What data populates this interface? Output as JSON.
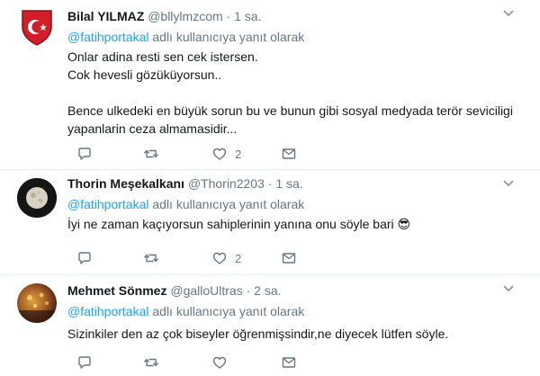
{
  "tweets": [
    {
      "name": "Bilal YILMAZ",
      "handle": "@bllylmzcom",
      "time": "1 sa.",
      "reply_mention": "@fatihportakal",
      "reply_suffix": " adlı kullanıcıya yanıt olarak",
      "lines": [
        "Onlar adina resti sen cek istersen.",
        "Cok hevesli gözüküyorsun..",
        "",
        "Bence ulkedeki en büyük sorun bu ve bunun gibi sosyal medyada terör seviciligi yapanlarin ceza almamasidir..."
      ],
      "likes": "2"
    },
    {
      "name": "Thorin Meşekalkanı",
      "handle": "@Thorin2203",
      "time": "1 sa.",
      "reply_mention": "@fatihportakal",
      "reply_suffix": " adlı kullanıcıya yanıt olarak",
      "lines": [
        "İyi ne zaman kaçıyorsun sahiplerinin yanına onu söyle bari"
      ],
      "emoji": "😎",
      "likes": "2"
    },
    {
      "name": "Mehmet Sönmez",
      "handle": "@galloUltras",
      "time": "2 sa.",
      "reply_mention": "@fatihportakal",
      "reply_suffix": " adlı kullanıcıya yanıt olarak",
      "lines": [
        "Sizinkiler den az çok biseyler öğrenmişsindir,ne diyecek lütfen söyle."
      ]
    }
  ],
  "separator": "·",
  "icons": {
    "reply": "reply-icon",
    "retweet": "retweet-icon",
    "like": "heart-icon",
    "message": "direct-message-icon",
    "more": "chevron-down-icon"
  },
  "colors": {
    "link": "#1da1f2",
    "secondary": "#657786",
    "text": "#14171a",
    "divider": "#e6ecf0"
  }
}
